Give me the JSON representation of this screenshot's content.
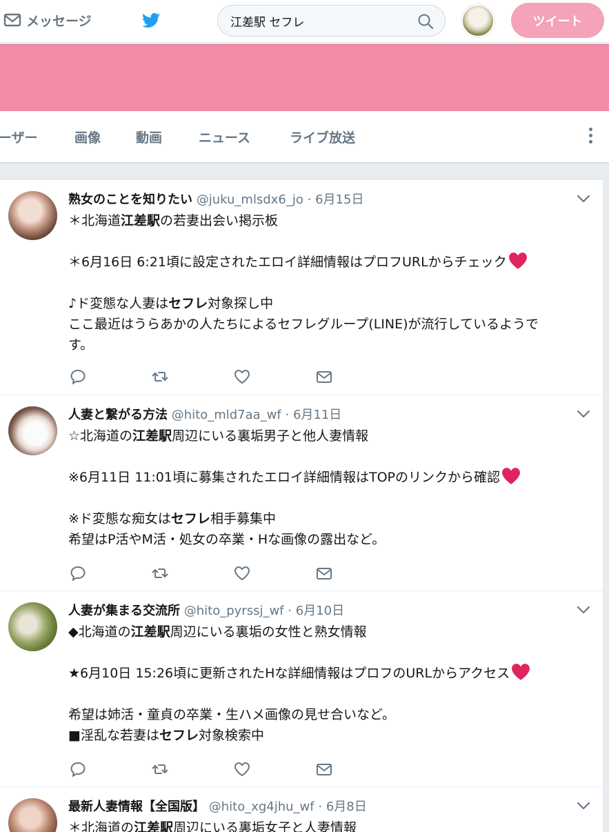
{
  "nav": {
    "messages_label": "メッセージ",
    "search_value": "江差駅 セフレ",
    "tweet_button": "ツイート"
  },
  "tabs": [
    "ーザー",
    "画像",
    "動画",
    "ニュース",
    "ライブ放送"
  ],
  "colors": {
    "banner": "#f38ca6",
    "tweet_button": "#f4a3b9",
    "heart_emoji": "#e0245e",
    "brand": "#1da1f2"
  },
  "tweets": [
    {
      "name": "熟女のことを知りたい",
      "handle": "@juku_mlsdx6_jo",
      "dot": "·",
      "date": "6月15日",
      "lines": [
        {
          "pre": "＊北海道",
          "bold": "江差駅",
          "post": "の若妻出会い掲示板"
        },
        {
          "pre": "",
          "bold": "",
          "post": ""
        },
        {
          "pre": "＊6月16日 6:21頃に設定されたエロイ詳細情報はプロフURLからチェック",
          "bold": "",
          "post": "",
          "heart": true
        },
        {
          "pre": "",
          "bold": "",
          "post": ""
        },
        {
          "pre": "♪ド変態な人妻は",
          "bold": "セフレ",
          "post": "対象探し中"
        },
        {
          "pre": "ここ最近はうらあかの人たちによるセフレグループ(LINE)が流行しているようで",
          "bold": "",
          "post": ""
        },
        {
          "pre": "す。",
          "bold": "",
          "post": ""
        }
      ]
    },
    {
      "name": "人妻と繋がる方法",
      "handle": "@hito_mld7aa_wf",
      "dot": "·",
      "date": "6月11日",
      "lines": [
        {
          "pre": "☆北海道の",
          "bold": "江差駅",
          "post": "周辺にいる裏垢男子と他人妻情報"
        },
        {
          "pre": "",
          "bold": "",
          "post": ""
        },
        {
          "pre": "※6月11日 11:01頃に募集されたエロイ詳細情報はTOPのリンクから確認",
          "bold": "",
          "post": "",
          "heart": true
        },
        {
          "pre": "",
          "bold": "",
          "post": ""
        },
        {
          "pre": "※ド変態な痴女は",
          "bold": "セフレ",
          "post": "相手募集中"
        },
        {
          "pre": "希望はP活やM活・処女の卒業・Hな画像の露出など。",
          "bold": "",
          "post": ""
        }
      ]
    },
    {
      "name": "人妻が集まる交流所",
      "handle": "@hito_pyrssj_wf",
      "dot": "·",
      "date": "6月10日",
      "lines": [
        {
          "pre": "◆北海道の",
          "bold": "江差駅",
          "post": "周辺にいる裏垢の女性と熟女情報"
        },
        {
          "pre": "",
          "bold": "",
          "post": ""
        },
        {
          "pre": "★6月10日 15:26頃に更新されたHな詳細情報はプロフのURLからアクセス",
          "bold": "",
          "post": "",
          "heart": true
        },
        {
          "pre": "",
          "bold": "",
          "post": ""
        },
        {
          "pre": "希望は姉活・童貞の卒業・生ハメ画像の見せ合いなど。",
          "bold": "",
          "post": ""
        },
        {
          "pre": "■淫乱な若妻は",
          "bold": "セフレ",
          "post": "対象検索中"
        }
      ]
    },
    {
      "name": "最新人妻情報【全国版】",
      "handle": "@hito_xg4jhu_wf",
      "dot": "·",
      "date": "6月8日",
      "lines": [
        {
          "pre": "＊北海道の",
          "bold": "江差駅",
          "post": "周辺にいる裏垢女子と人妻情報"
        }
      ]
    }
  ]
}
